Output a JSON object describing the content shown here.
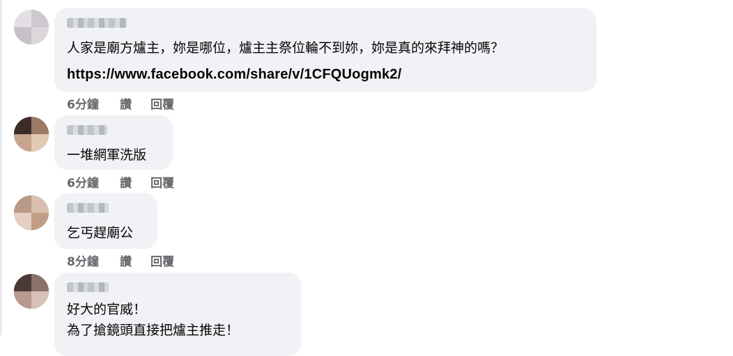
{
  "comments": [
    {
      "lines": [
        "人家是廟方爐主，妳是哪位，爐主主祭位輪不到妳，妳是真的來拜神的嗎？"
      ],
      "link": "https://www.facebook.com/share/v/1CFQUogmk2/",
      "time": "6分鐘",
      "like_label": "讚",
      "reply_label": "回覆"
    },
    {
      "lines": [
        "一堆網軍洗版"
      ],
      "time": "6分鐘",
      "like_label": "讚",
      "reply_label": "回覆"
    },
    {
      "lines": [
        "乞丐趕廟公"
      ],
      "time": "8分鐘",
      "like_label": "讚",
      "reply_label": "回覆"
    },
    {
      "lines": [
        "好大的官威！",
        "為了搶鏡頭直接把爐主推走！"
      ]
    }
  ],
  "colors": {
    "bubble_bg": "#f0f2f5",
    "action_text": "#65676b",
    "text": "#050505"
  }
}
